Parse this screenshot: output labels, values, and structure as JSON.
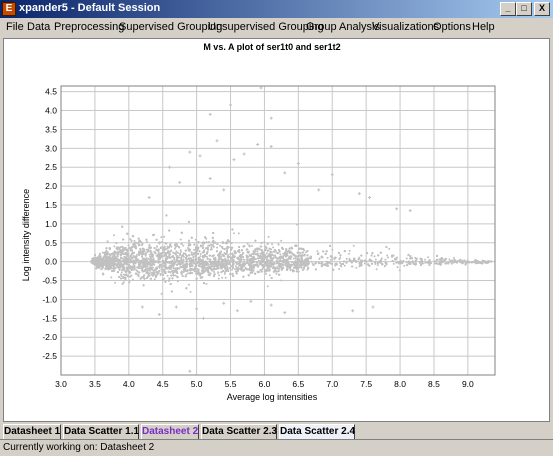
{
  "window": {
    "icon_letter": "E",
    "title": "xpander5 - Default Session",
    "minimize_label": "_",
    "maximize_label": "□",
    "close_label": "X"
  },
  "menu": [
    "File",
    "Data",
    "Preprocessing",
    "Supervised Grouping",
    "Unsupervised Grouping",
    "Group Analysis",
    "Visualizations",
    "Options",
    "Help"
  ],
  "tabs": [
    {
      "label": "Datasheet 1",
      "color": "#000000",
      "active": false
    },
    {
      "label": "Data Scatter 1.1",
      "color": "#000000",
      "active": false
    },
    {
      "label": "Datasheet 2",
      "color": "#7a2cc4",
      "active": false
    },
    {
      "label": "Data Scatter 2.3",
      "color": "#000000",
      "active": false
    },
    {
      "label": "Data Scatter 2.4",
      "color": "#000000",
      "active": true
    }
  ],
  "status": {
    "text": "Currently working on: Datasheet 2"
  },
  "chart_data": {
    "type": "scatter",
    "title": "M vs. A plot of ser1t0 and ser1t2",
    "xlabel": "Average log intensities",
    "ylabel": "Log intensity difference",
    "xlim": [
      3.0,
      9.4
    ],
    "ylim": [
      -3.0,
      4.65
    ],
    "xticks": [
      "3.0",
      "3.5",
      "4.0",
      "4.5",
      "5.0",
      "5.5",
      "6.0",
      "6.5",
      "7.0",
      "7.5",
      "8.0",
      "8.5",
      "9.0"
    ],
    "yticks": [
      "4.5",
      "4.0",
      "3.5",
      "3.0",
      "2.5",
      "2.0",
      "1.5",
      "1.0",
      "0.5",
      "0.0",
      "-0.5",
      "-1.0",
      "-1.5",
      "-2.0",
      "-2.5"
    ],
    "grid": true,
    "point_color": "#c0c0c0",
    "approx_point_count": 9000,
    "point_cloud_envelope": {
      "x": [
        3.45,
        3.7,
        4.0,
        4.5,
        5.0,
        5.5,
        6.0,
        6.5,
        7.0,
        7.5,
        8.0,
        8.5,
        9.0,
        9.35
      ],
      "upper_y": [
        0.05,
        0.6,
        1.1,
        1.2,
        1.2,
        1.0,
        0.9,
        0.75,
        0.6,
        0.5,
        0.35,
        0.25,
        0.15,
        0.05
      ],
      "lower_y": [
        -0.05,
        -0.55,
        -0.9,
        -0.9,
        -0.8,
        -0.7,
        -0.6,
        -0.5,
        -0.4,
        -0.35,
        -0.25,
        -0.2,
        -0.12,
        -0.05
      ]
    },
    "outliers": [
      {
        "x": 5.95,
        "y": 4.6
      },
      {
        "x": 5.5,
        "y": 4.15
      },
      {
        "x": 5.2,
        "y": 3.9
      },
      {
        "x": 6.1,
        "y": 3.8
      },
      {
        "x": 5.3,
        "y": 3.2
      },
      {
        "x": 5.9,
        "y": 3.1
      },
      {
        "x": 6.1,
        "y": 3.05
      },
      {
        "x": 4.9,
        "y": 2.9
      },
      {
        "x": 5.05,
        "y": 2.8
      },
      {
        "x": 5.55,
        "y": 2.7
      },
      {
        "x": 5.7,
        "y": 2.85
      },
      {
        "x": 6.5,
        "y": 2.6
      },
      {
        "x": 4.6,
        "y": 2.5
      },
      {
        "x": 6.3,
        "y": 2.35
      },
      {
        "x": 7.0,
        "y": 2.3
      },
      {
        "x": 4.75,
        "y": 2.1
      },
      {
        "x": 5.2,
        "y": 2.2
      },
      {
        "x": 6.8,
        "y": 1.9
      },
      {
        "x": 7.4,
        "y": 1.8
      },
      {
        "x": 7.55,
        "y": 1.7
      },
      {
        "x": 7.95,
        "y": 1.4
      },
      {
        "x": 8.15,
        "y": 1.35
      },
      {
        "x": 6.0,
        "y": 2.0
      },
      {
        "x": 5.4,
        "y": 1.9
      },
      {
        "x": 4.3,
        "y": 1.7
      },
      {
        "x": 4.2,
        "y": -1.2
      },
      {
        "x": 4.45,
        "y": -1.4
      },
      {
        "x": 5.1,
        "y": -1.5
      },
      {
        "x": 5.0,
        "y": -1.25
      },
      {
        "x": 5.4,
        "y": -1.1
      },
      {
        "x": 6.1,
        "y": -1.15
      },
      {
        "x": 6.3,
        "y": -1.35
      },
      {
        "x": 7.3,
        "y": -1.3
      },
      {
        "x": 7.6,
        "y": -1.2
      },
      {
        "x": 5.8,
        "y": -1.05
      },
      {
        "x": 4.7,
        "y": -1.2
      },
      {
        "x": 5.6,
        "y": -1.3
      },
      {
        "x": 4.9,
        "y": -2.9
      }
    ]
  }
}
